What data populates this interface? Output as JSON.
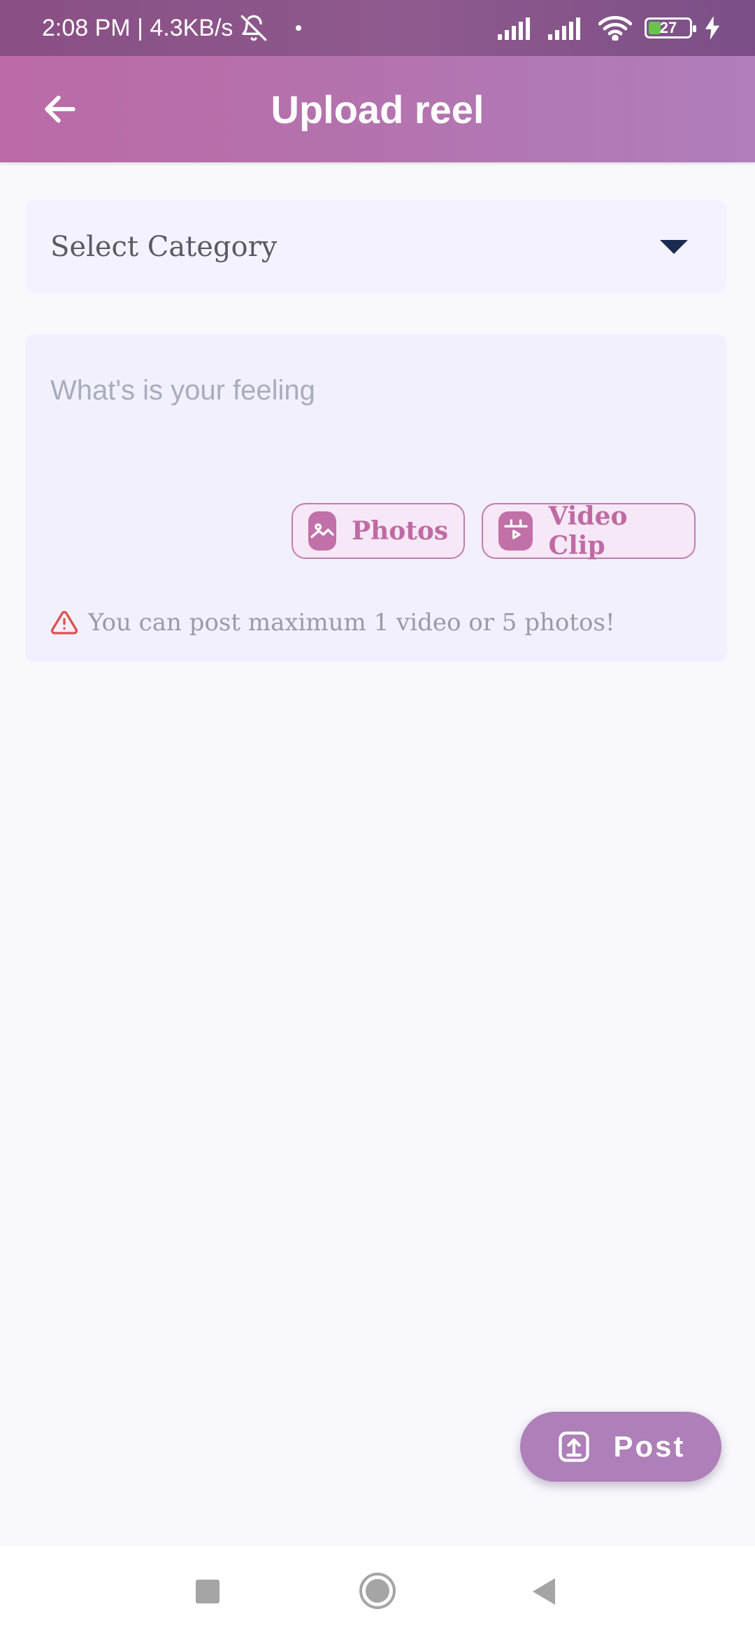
{
  "status_bar": {
    "time_speed": "2:08 PM | 4.3KB/s",
    "battery_level": "27",
    "icons": [
      "bell-off-icon",
      "signal-icon",
      "signal-icon",
      "wifi-icon",
      "battery-icon",
      "charging-icon"
    ]
  },
  "app_bar": {
    "title": "Upload reel",
    "back_icon": "arrow-left-icon"
  },
  "category": {
    "selected": "Select Category",
    "icon": "caret-down-icon"
  },
  "composer": {
    "placeholder": "What's is your feeling",
    "value": "",
    "photos_label": "Photos",
    "video_label": "Video Clip",
    "warning": "You can post maximum 1 video or 5 photos!"
  },
  "post_button": {
    "label": "Post",
    "icon": "upload-icon"
  },
  "nav": {
    "icons": [
      "recents-square-icon",
      "home-circle-icon",
      "back-triangle-icon"
    ]
  },
  "colors": {
    "status_bar": "#8a4f85",
    "app_bar": "#bc6aa6",
    "accent": "#c270a8",
    "post_button": "#ae7fb8",
    "warning": "#d9534f",
    "background": "#f8f8fd"
  }
}
